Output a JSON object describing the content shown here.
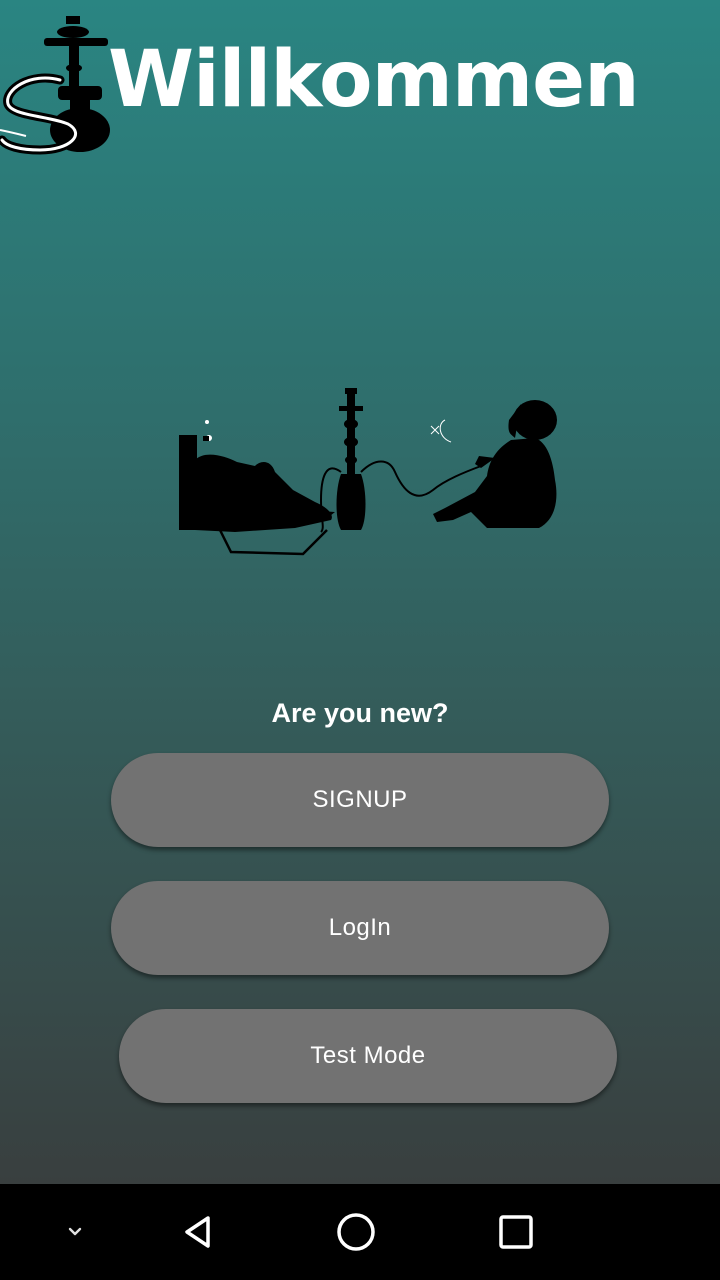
{
  "header": {
    "title": "Willkommen",
    "logo_icon": "hookah-logo-icon"
  },
  "illustration": {
    "icon": "people-smoking-hookah-illustration"
  },
  "main": {
    "question": "Are you new?",
    "signup_label": "SIGNUP",
    "login_label": "LogIn",
    "test_mode_label": "Test Mode"
  },
  "navbar": {
    "items": [
      "chevron-down-icon",
      "back-icon",
      "home-icon",
      "recents-icon"
    ]
  },
  "colors": {
    "gradient_top": "#2a8582",
    "gradient_bottom": "#393f3f",
    "button_bg": "#727272",
    "text": "#ffffff",
    "navbar_bg": "#000000"
  }
}
